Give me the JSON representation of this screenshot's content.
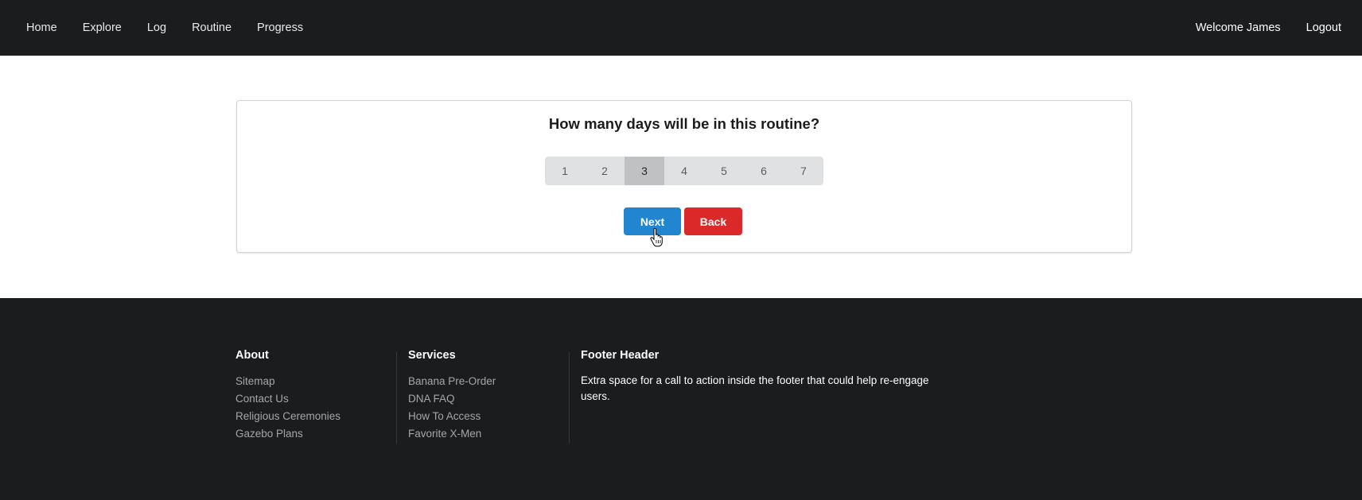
{
  "nav": {
    "left": [
      "Home",
      "Explore",
      "Log",
      "Routine",
      "Progress"
    ],
    "welcome": "Welcome James",
    "logout": "Logout"
  },
  "form": {
    "question": "How many days will be in this routine?",
    "days": [
      "1",
      "2",
      "3",
      "4",
      "5",
      "6",
      "7"
    ],
    "selected_day": "3",
    "next_label": "Next",
    "back_label": "Back"
  },
  "footer": {
    "about": {
      "title": "About",
      "links": [
        "Sitemap",
        "Contact Us",
        "Religious Ceremonies",
        "Gazebo Plans"
      ]
    },
    "services": {
      "title": "Services",
      "links": [
        "Banana Pre-Order",
        "DNA FAQ",
        "How To Access",
        "Favorite X-Men"
      ]
    },
    "extra": {
      "title": "Footer Header",
      "text": "Extra space for a call to action inside the footer that could help re-engage users."
    }
  },
  "colors": {
    "nav_bg": "#1b1c1d",
    "primary": "#2185d0",
    "danger": "#db2828",
    "day_selector_bg": "#e0e1e2",
    "day_active_bg": "#c0c1c2"
  },
  "icons": {
    "cursor": "hand-pointer-icon"
  }
}
